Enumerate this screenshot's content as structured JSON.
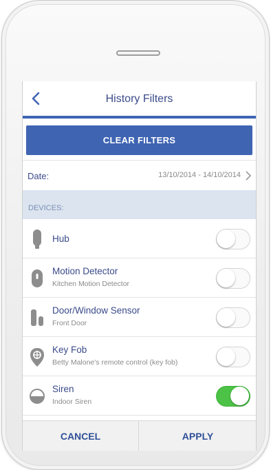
{
  "header": {
    "title": "History Filters",
    "back_icon": "chevron-left-icon"
  },
  "clear_button": "CLEAR FILTERS",
  "date": {
    "label": "Date:",
    "value": "13/10/2014 - 14/10/2014"
  },
  "devices_header": "DEVICES:",
  "devices": [
    {
      "name": "Hub",
      "sub": "",
      "icon": "hub-icon",
      "enabled": false
    },
    {
      "name": "Motion Detector",
      "sub": "Kitchen Motion Detector",
      "icon": "motion-detector-icon",
      "enabled": false
    },
    {
      "name": "Door/Window Sensor",
      "sub": "Front Door",
      "icon": "door-sensor-icon",
      "enabled": false
    },
    {
      "name": "Key Fob",
      "sub": "Betty Malone's remote control (key fob)",
      "icon": "key-fob-icon",
      "enabled": false
    },
    {
      "name": "Siren",
      "sub": "Indoor Siren",
      "icon": "siren-icon",
      "enabled": true
    }
  ],
  "footer": {
    "cancel": "CANCEL",
    "apply": "APPLY"
  },
  "colors": {
    "accent": "#3f64b2",
    "toggle_on": "#4cc247",
    "section_bg": "#dbe4ef",
    "icon": "#8d8d8d"
  }
}
